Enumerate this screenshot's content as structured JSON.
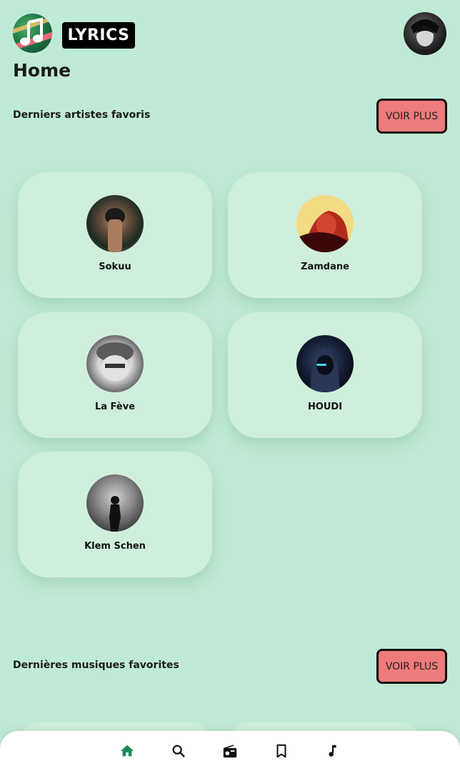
{
  "header": {
    "logo_text": "LYRICS"
  },
  "page": {
    "title": "Home"
  },
  "artists_section": {
    "title": "Derniers artistes favoris",
    "button_label": "VOIR PLUS",
    "artists": [
      {
        "name": "Sokuu"
      },
      {
        "name": "Zamdane"
      },
      {
        "name": "La Fève"
      },
      {
        "name": "HOUDI"
      },
      {
        "name": "Klem Schen"
      }
    ]
  },
  "music_section": {
    "title": "Dernières musiques favorites",
    "button_label": "VOIR PLUS"
  },
  "nav": {
    "items": [
      {
        "icon": "home-icon",
        "active": true
      },
      {
        "icon": "search-icon",
        "active": false
      },
      {
        "icon": "radio-icon",
        "active": false
      },
      {
        "icon": "bookmark-icon",
        "active": false
      },
      {
        "icon": "music-note-icon",
        "active": false
      }
    ]
  },
  "colors": {
    "background": "#bfead5",
    "card": "#cfefdc",
    "button": "#ef7b7b",
    "nav_active": "#1d8a5a"
  }
}
